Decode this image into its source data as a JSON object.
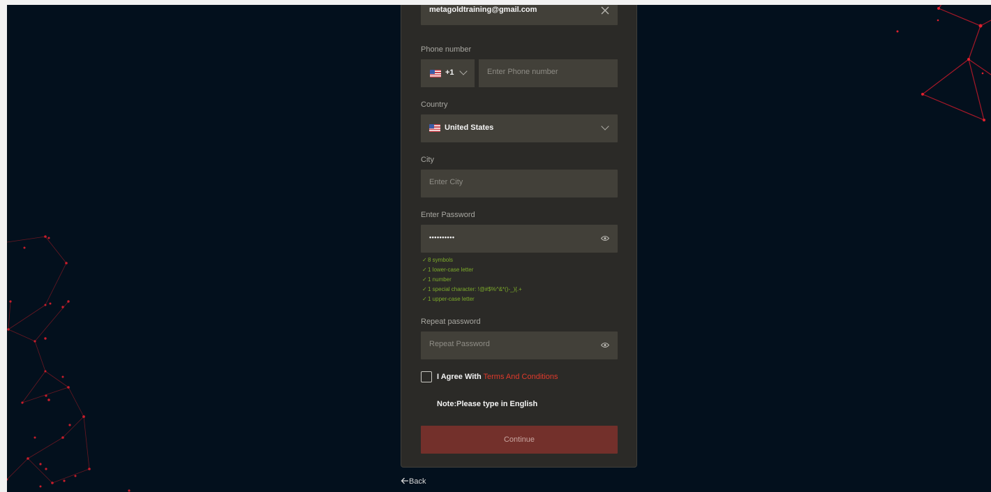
{
  "form": {
    "email_value": "metagoldtraining@gmail.com",
    "phone": {
      "label": "Phone number",
      "country_code": "+1",
      "placeholder": "Enter Phone number"
    },
    "country": {
      "label": "Country",
      "selected": "United States"
    },
    "city": {
      "label": "City",
      "placeholder": "Enter City"
    },
    "password": {
      "label": "Enter Password",
      "masked_value": "••••••••••",
      "requirements": [
        "8 symbols",
        "1 lower-case letter",
        "1 number",
        "1 special character: !@#$%^&*()-_){.+",
        "1 upper-case letter"
      ]
    },
    "repeat_password": {
      "label": "Repeat password",
      "placeholder": "Repeat Password"
    },
    "agree": {
      "prefix": "I Agree With",
      "link": "Terms And Conditions"
    },
    "note": "Note:Please type in English",
    "continue_label": "Continue"
  },
  "back_label": "Back",
  "colors": {
    "background": "#03101d",
    "card": "#2b2a27",
    "field": "#424039",
    "accent_red": "#e03a2c",
    "requirement_ok": "#7dab2a",
    "continue_button": "#73302b"
  },
  "icons": {
    "clear": "close-icon",
    "dropdown": "chevron-down-icon",
    "reveal": "eye-icon",
    "check": "check-icon",
    "back": "arrow-left-icon",
    "flag": "us-flag-icon"
  }
}
